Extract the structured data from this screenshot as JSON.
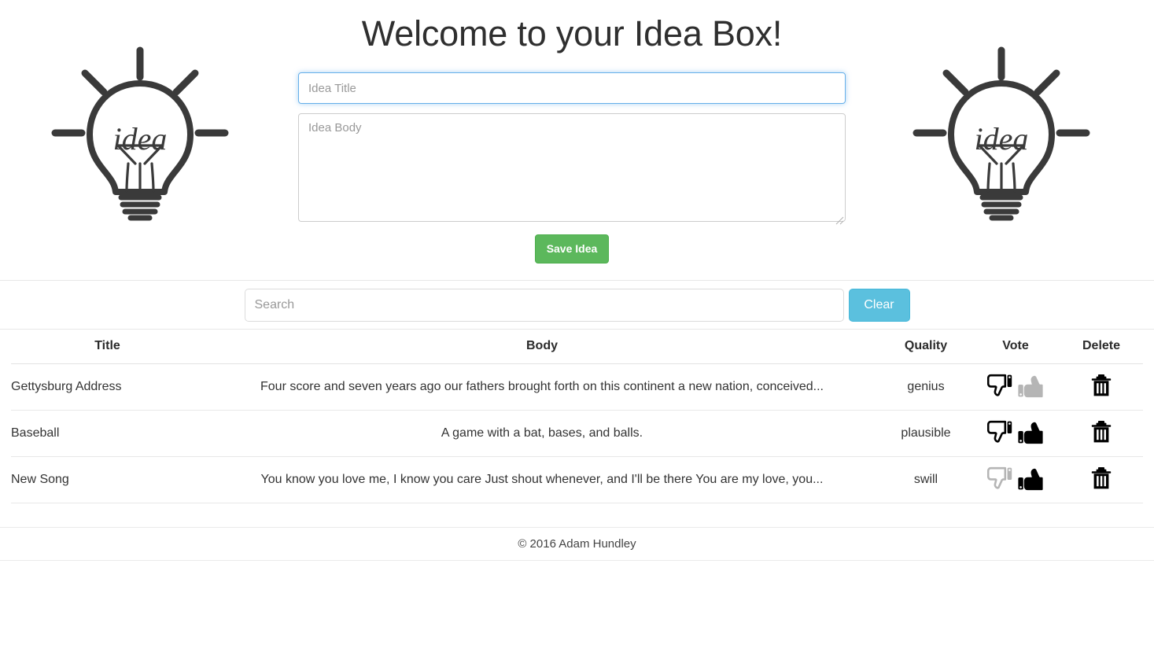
{
  "header": {
    "title": "Welcome to your Idea Box!",
    "bulb_word": "idea",
    "left_bulb_name": "idea-lightbulb-left",
    "right_bulb_name": "idea-lightbulb-right"
  },
  "form": {
    "title_placeholder": "Idea Title",
    "title_value": "",
    "body_placeholder": "Idea Body",
    "body_value": "",
    "save_label": "Save Idea",
    "save_color": "#5cb85c"
  },
  "search": {
    "placeholder": "Search",
    "value": "",
    "clear_label": "Clear",
    "clear_color": "#5bc0de"
  },
  "table": {
    "columns": [
      "Title",
      "Body",
      "Quality",
      "Vote",
      "Delete"
    ],
    "rows": [
      {
        "title": "Gettysburg Address",
        "body": "Four score and seven years ago our fathers brought forth on this continent a new nation, conceived...",
        "quality": "genius",
        "downvote_state": "active",
        "upvote_state": "inactive"
      },
      {
        "title": "Baseball",
        "body": "A game with a bat, bases, and balls.",
        "quality": "plausible",
        "downvote_state": "active",
        "upvote_state": "active"
      },
      {
        "title": "New Song",
        "body": "You know you love me, I know you care Just shout whenever, and I'll be there You are my love, you...",
        "quality": "swill",
        "downvote_state": "inactive",
        "upvote_state": "active"
      }
    ]
  },
  "footer": {
    "copyright": "© 2016 Adam Hundley"
  },
  "colors": {
    "icon_on": "#000000",
    "icon_off": "#b5b5b5",
    "text": "#333333",
    "border": "#e2e2e2"
  }
}
